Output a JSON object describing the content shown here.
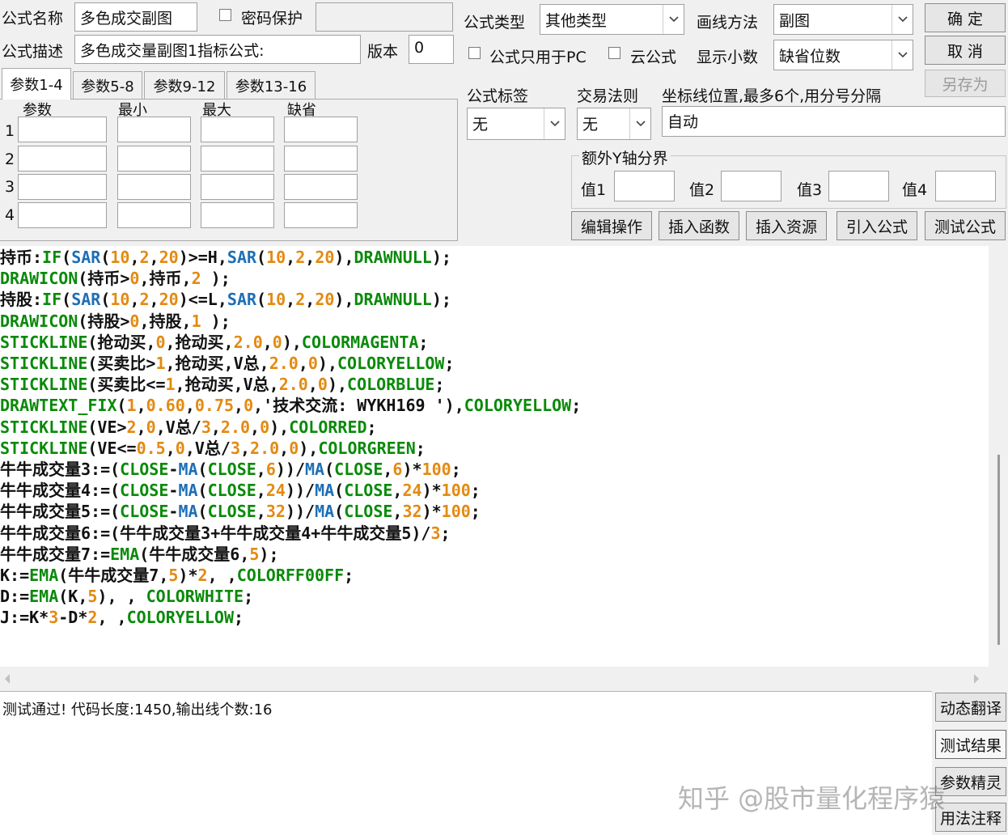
{
  "header": {
    "name_label": "公式名称",
    "name_value": "多色成交副图",
    "password_label": "密码保护",
    "password_value": "",
    "desc_label": "公式描述",
    "desc_value": "多色成交量副图1指标公式:",
    "version_label": "版本",
    "version_value": "0",
    "type_label": "公式类型",
    "type_value": "其他类型",
    "draw_label": "画线方法",
    "draw_value": "副图",
    "pc_only_label": "公式只用于PC",
    "cloud_label": "云公式",
    "decimals_label": "显示小数",
    "decimals_value": "缺省位数",
    "tag_label": "公式标签",
    "tag_value": "无",
    "rule_label": "交易法则",
    "rule_value": "无",
    "axis_label": "坐标线位置,最多6个,用分号分隔",
    "axis_value": "自动",
    "yaxis_group": "额外Y轴分界",
    "y1": "值1",
    "y2": "值2",
    "y3": "值3",
    "y4": "值4"
  },
  "buttons": {
    "ok": "确  定",
    "cancel": "取  消",
    "save_as": "另存为",
    "edit_ops": "编辑操作",
    "insert_func": "插入函数",
    "insert_res": "插入资源",
    "import_formula": "引入公式",
    "test_formula": "测试公式"
  },
  "params": {
    "tabs": [
      "参数1-4",
      "参数5-8",
      "参数9-12",
      "参数13-16"
    ],
    "columns": [
      "参数",
      "最小",
      "最大",
      "缺省"
    ],
    "rows": [
      "1",
      "2",
      "3",
      "4"
    ]
  },
  "code_lines": [
    [
      [
        "持币:",
        "#111"
      ],
      [
        "IF",
        "#0a8a0a"
      ],
      [
        "(",
        "#111"
      ],
      [
        "SAR",
        "#1e6fb5"
      ],
      [
        "(",
        "#111"
      ],
      [
        "10",
        "#e38a12"
      ],
      [
        ",",
        "#111"
      ],
      [
        "2",
        "#e38a12"
      ],
      [
        ",",
        "#111"
      ],
      [
        "20",
        "#e38a12"
      ],
      [
        ")>=H,",
        "#111"
      ],
      [
        "SAR",
        "#1e6fb5"
      ],
      [
        "(",
        "#111"
      ],
      [
        "10",
        "#e38a12"
      ],
      [
        ",",
        "#111"
      ],
      [
        "2",
        "#e38a12"
      ],
      [
        ",",
        "#111"
      ],
      [
        "20",
        "#e38a12"
      ],
      [
        "),",
        "#111"
      ],
      [
        "DRAWNULL",
        "#0a8a0a"
      ],
      [
        ");",
        "#111"
      ]
    ],
    [
      [
        "DRAWICON",
        "#0a8a0a"
      ],
      [
        "(持币>",
        "#111"
      ],
      [
        "0",
        "#e38a12"
      ],
      [
        ",持币,",
        "#111"
      ],
      [
        "2",
        "#e38a12"
      ],
      [
        " );",
        "#111"
      ]
    ],
    [
      [
        "持股:",
        "#111"
      ],
      [
        "IF",
        "#0a8a0a"
      ],
      [
        "(",
        "#111"
      ],
      [
        "SAR",
        "#1e6fb5"
      ],
      [
        "(",
        "#111"
      ],
      [
        "10",
        "#e38a12"
      ],
      [
        ",",
        "#111"
      ],
      [
        "2",
        "#e38a12"
      ],
      [
        ",",
        "#111"
      ],
      [
        "20",
        "#e38a12"
      ],
      [
        ")<=L,",
        "#111"
      ],
      [
        "SAR",
        "#1e6fb5"
      ],
      [
        "(",
        "#111"
      ],
      [
        "10",
        "#e38a12"
      ],
      [
        ",",
        "#111"
      ],
      [
        "2",
        "#e38a12"
      ],
      [
        ",",
        "#111"
      ],
      [
        "20",
        "#e38a12"
      ],
      [
        "),",
        "#111"
      ],
      [
        "DRAWNULL",
        "#0a8a0a"
      ],
      [
        ");",
        "#111"
      ]
    ],
    [
      [
        "DRAWICON",
        "#0a8a0a"
      ],
      [
        "(持股>",
        "#111"
      ],
      [
        "0",
        "#e38a12"
      ],
      [
        ",持股,",
        "#111"
      ],
      [
        "1",
        "#e38a12"
      ],
      [
        " );",
        "#111"
      ]
    ],
    [
      [
        "STICKLINE",
        "#0a8a0a"
      ],
      [
        "(抢动买,",
        "#111"
      ],
      [
        "0",
        "#e38a12"
      ],
      [
        ",抢动买,",
        "#111"
      ],
      [
        "2.0",
        "#e38a12"
      ],
      [
        ",",
        "#111"
      ],
      [
        "0",
        "#e38a12"
      ],
      [
        "),",
        "#111"
      ],
      [
        "COLORMAGENTA",
        "#0a8a0a"
      ],
      [
        ";",
        "#111"
      ]
    ],
    [
      [
        "STICKLINE",
        "#0a8a0a"
      ],
      [
        "(买卖比>",
        "#111"
      ],
      [
        "1",
        "#e38a12"
      ],
      [
        ",抢动买,V总,",
        "#111"
      ],
      [
        "2.0",
        "#e38a12"
      ],
      [
        ",",
        "#111"
      ],
      [
        "0",
        "#e38a12"
      ],
      [
        "),",
        "#111"
      ],
      [
        "COLORYELLOW",
        "#0a8a0a"
      ],
      [
        ";",
        "#111"
      ]
    ],
    [
      [
        "STICKLINE",
        "#0a8a0a"
      ],
      [
        "(买卖比<=",
        "#111"
      ],
      [
        "1",
        "#e38a12"
      ],
      [
        ",抢动买,V总,",
        "#111"
      ],
      [
        "2.0",
        "#e38a12"
      ],
      [
        ",",
        "#111"
      ],
      [
        "0",
        "#e38a12"
      ],
      [
        "),",
        "#111"
      ],
      [
        "COLORBLUE",
        "#0a8a0a"
      ],
      [
        ";",
        "#111"
      ]
    ],
    [
      [
        "DRAWTEXT_FIX",
        "#0a8a0a"
      ],
      [
        "(",
        "#111"
      ],
      [
        "1",
        "#e38a12"
      ],
      [
        ",",
        "#111"
      ],
      [
        "0.60",
        "#e38a12"
      ],
      [
        ",",
        "#111"
      ],
      [
        "0.75",
        "#e38a12"
      ],
      [
        ",",
        "#111"
      ],
      [
        "0",
        "#e38a12"
      ],
      [
        ",'技术交流: WYKH169 '),",
        "#111"
      ],
      [
        "COLORYELLOW",
        "#0a8a0a"
      ],
      [
        ";",
        "#111"
      ]
    ],
    [
      [
        "STICKLINE",
        "#0a8a0a"
      ],
      [
        "(VE>",
        "#111"
      ],
      [
        "2",
        "#e38a12"
      ],
      [
        ",",
        "#111"
      ],
      [
        "0",
        "#e38a12"
      ],
      [
        ",V总/",
        "#111"
      ],
      [
        "3",
        "#e38a12"
      ],
      [
        ",",
        "#111"
      ],
      [
        "2.0",
        "#e38a12"
      ],
      [
        ",",
        "#111"
      ],
      [
        "0",
        "#e38a12"
      ],
      [
        "),",
        "#111"
      ],
      [
        "COLORRED",
        "#0a8a0a"
      ],
      [
        ";",
        "#111"
      ]
    ],
    [
      [
        "STICKLINE",
        "#0a8a0a"
      ],
      [
        "(VE<=",
        "#111"
      ],
      [
        "0.5",
        "#e38a12"
      ],
      [
        ",",
        "#111"
      ],
      [
        "0",
        "#e38a12"
      ],
      [
        ",V总/",
        "#111"
      ],
      [
        "3",
        "#e38a12"
      ],
      [
        ",",
        "#111"
      ],
      [
        "2.0",
        "#e38a12"
      ],
      [
        ",",
        "#111"
      ],
      [
        "0",
        "#e38a12"
      ],
      [
        "),",
        "#111"
      ],
      [
        "COLORGREEN",
        "#0a8a0a"
      ],
      [
        ";",
        "#111"
      ]
    ],
    [
      [
        "牛牛成交量3:=(",
        "#111"
      ],
      [
        "CLOSE",
        "#0a8a0a"
      ],
      [
        "-",
        "#111"
      ],
      [
        "MA",
        "#1e6fb5"
      ],
      [
        "(",
        "#111"
      ],
      [
        "CLOSE",
        "#0a8a0a"
      ],
      [
        ",",
        "#111"
      ],
      [
        "6",
        "#e38a12"
      ],
      [
        "))/",
        "#111"
      ],
      [
        "MA",
        "#1e6fb5"
      ],
      [
        "(",
        "#111"
      ],
      [
        "CLOSE",
        "#0a8a0a"
      ],
      [
        ",",
        "#111"
      ],
      [
        "6",
        "#e38a12"
      ],
      [
        ")*",
        "#111"
      ],
      [
        "100",
        "#e38a12"
      ],
      [
        ";",
        "#111"
      ]
    ],
    [
      [
        "牛牛成交量4:=(",
        "#111"
      ],
      [
        "CLOSE",
        "#0a8a0a"
      ],
      [
        "-",
        "#111"
      ],
      [
        "MA",
        "#1e6fb5"
      ],
      [
        "(",
        "#111"
      ],
      [
        "CLOSE",
        "#0a8a0a"
      ],
      [
        ",",
        "#111"
      ],
      [
        "24",
        "#e38a12"
      ],
      [
        "))/",
        "#111"
      ],
      [
        "MA",
        "#1e6fb5"
      ],
      [
        "(",
        "#111"
      ],
      [
        "CLOSE",
        "#0a8a0a"
      ],
      [
        ",",
        "#111"
      ],
      [
        "24",
        "#e38a12"
      ],
      [
        ")*",
        "#111"
      ],
      [
        "100",
        "#e38a12"
      ],
      [
        ";",
        "#111"
      ]
    ],
    [
      [
        "牛牛成交量5:=(",
        "#111"
      ],
      [
        "CLOSE",
        "#0a8a0a"
      ],
      [
        "-",
        "#111"
      ],
      [
        "MA",
        "#1e6fb5"
      ],
      [
        "(",
        "#111"
      ],
      [
        "CLOSE",
        "#0a8a0a"
      ],
      [
        ",",
        "#111"
      ],
      [
        "32",
        "#e38a12"
      ],
      [
        "))/",
        "#111"
      ],
      [
        "MA",
        "#1e6fb5"
      ],
      [
        "(",
        "#111"
      ],
      [
        "CLOSE",
        "#0a8a0a"
      ],
      [
        ",",
        "#111"
      ],
      [
        "32",
        "#e38a12"
      ],
      [
        ")*",
        "#111"
      ],
      [
        "100",
        "#e38a12"
      ],
      [
        ";",
        "#111"
      ]
    ],
    [
      [
        "牛牛成交量6:=(牛牛成交量3+牛牛成交量4+牛牛成交量5)/",
        "#111"
      ],
      [
        "3",
        "#e38a12"
      ],
      [
        ";",
        "#111"
      ]
    ],
    [
      [
        "牛牛成交量7:=",
        "#111"
      ],
      [
        "EMA",
        "#0a8a0a"
      ],
      [
        "(牛牛成交量6,",
        "#111"
      ],
      [
        "5",
        "#e38a12"
      ],
      [
        ");",
        "#111"
      ]
    ],
    [
      [
        "K:=",
        "#111"
      ],
      [
        "EMA",
        "#0a8a0a"
      ],
      [
        "(牛牛成交量7,",
        "#111"
      ],
      [
        "5",
        "#e38a12"
      ],
      [
        ")*",
        "#111"
      ],
      [
        "2",
        "#e38a12"
      ],
      [
        ", ,",
        "#111"
      ],
      [
        "COLORFF00FF",
        "#0a8a0a"
      ],
      [
        ";",
        "#111"
      ]
    ],
    [
      [
        "D:=",
        "#111"
      ],
      [
        "EMA",
        "#0a8a0a"
      ],
      [
        "(K,",
        "#111"
      ],
      [
        "5",
        "#e38a12"
      ],
      [
        "), , ",
        "#111"
      ],
      [
        "COLORWHITE",
        "#0a8a0a"
      ],
      [
        ";",
        "#111"
      ]
    ],
    [
      [
        "J:=K*",
        "#111"
      ],
      [
        "3",
        "#e38a12"
      ],
      [
        "-D*",
        "#111"
      ],
      [
        "2",
        "#e38a12"
      ],
      [
        ", ,",
        "#111"
      ],
      [
        "COLORYELLOW",
        "#0a8a0a"
      ],
      [
        ";",
        "#111"
      ]
    ]
  ],
  "result": {
    "message": "测试通过! 代码长度:1450,输出线个数:16"
  },
  "side_buttons": [
    "动态翻译",
    "测试结果",
    "参数精灵",
    "用法注释"
  ],
  "watermark": "知乎 @股市量化程序猿",
  "colors": {
    "keyword_green": "#0a8a0a",
    "function_blue": "#1e6fb5",
    "number_orange": "#e38a12",
    "text": "#111111"
  }
}
